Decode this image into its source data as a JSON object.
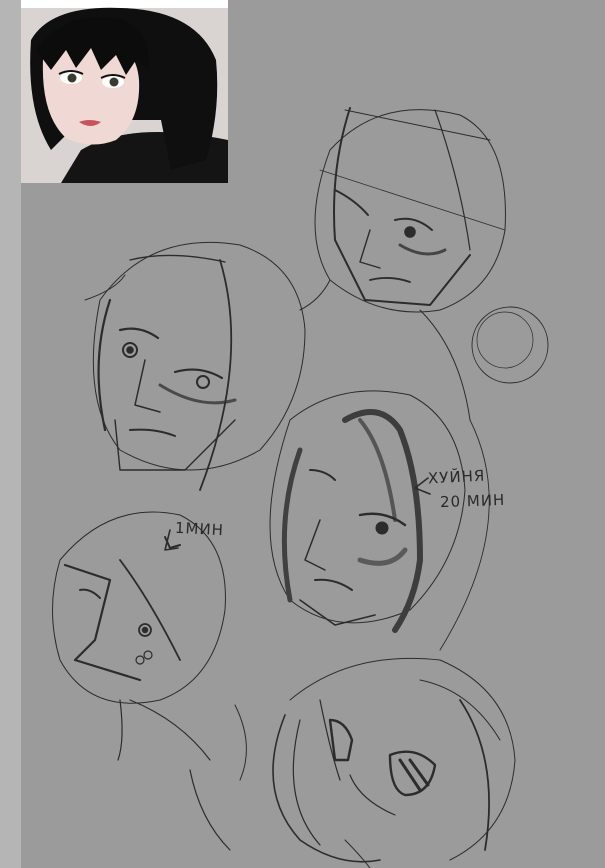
{
  "annotations": {
    "one_minute": "1МИН",
    "bad_label": "ХУЙНЯ",
    "twenty_minutes": "20 МИН"
  },
  "reference_photo": {
    "icon": "reference-photo-icon"
  }
}
